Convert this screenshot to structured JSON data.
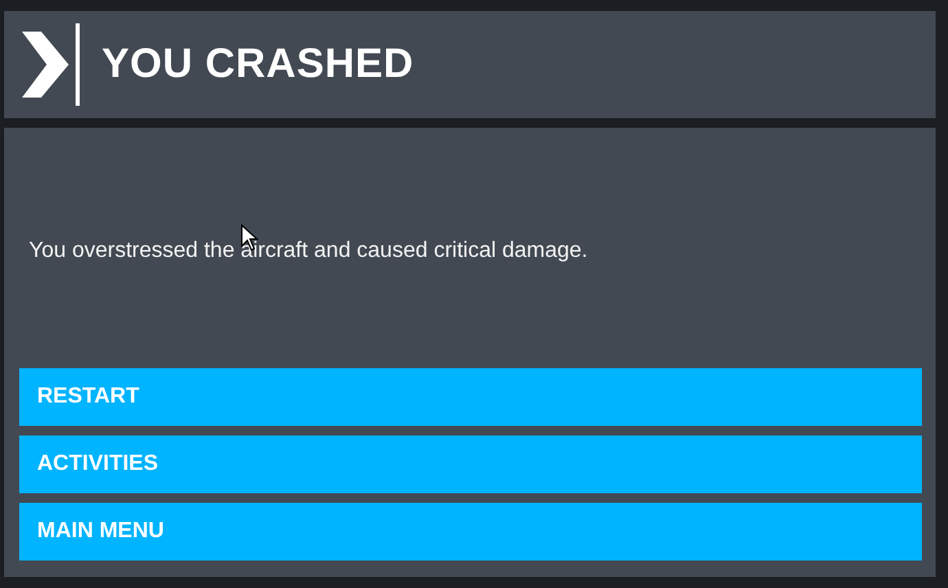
{
  "dialog": {
    "title": "YOU CRASHED",
    "message": "You overstressed the aircraft and caused critical damage.",
    "buttons": [
      {
        "label": "RESTART"
      },
      {
        "label": "ACTIVITIES"
      },
      {
        "label": "MAIN MENU"
      }
    ]
  }
}
